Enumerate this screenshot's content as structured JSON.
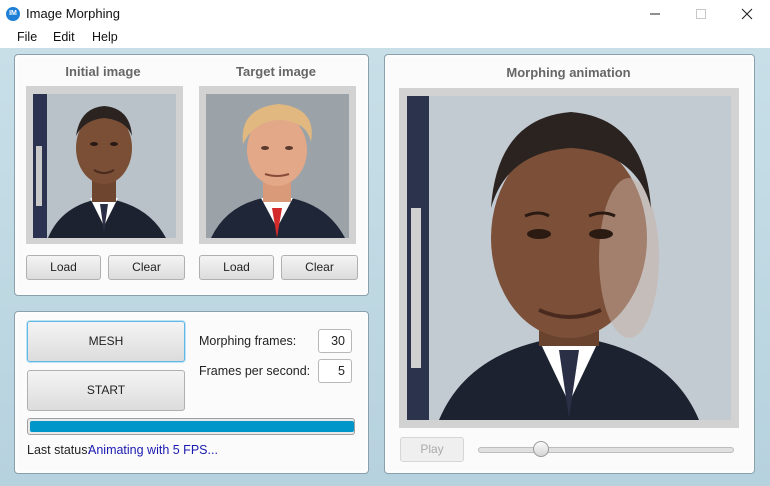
{
  "window": {
    "title": "Image Morphing",
    "icon_text": "IM"
  },
  "menu": {
    "items": [
      "File",
      "Edit",
      "Help"
    ]
  },
  "images_panel": {
    "initial": {
      "title": "Initial image",
      "load_label": "Load",
      "clear_label": "Clear"
    },
    "target": {
      "title": "Target image",
      "load_label": "Load",
      "clear_label": "Clear"
    }
  },
  "controls": {
    "mesh_label": "MESH",
    "start_label": "START",
    "morphing_frames_label": "Morphing frames:",
    "morphing_frames_value": "30",
    "fps_label": "Frames per second:",
    "fps_value": "5",
    "progress": 1.0,
    "status_label": "Last status:",
    "status_text": "Animating with 5 FPS..."
  },
  "animation_panel": {
    "title": "Morphing animation",
    "play_label": "Play",
    "slider_fraction": 0.23
  },
  "colors": {
    "accent": "#0096c9",
    "status_text": "#1a1ab0",
    "app_icon": "#1e7fd6"
  }
}
